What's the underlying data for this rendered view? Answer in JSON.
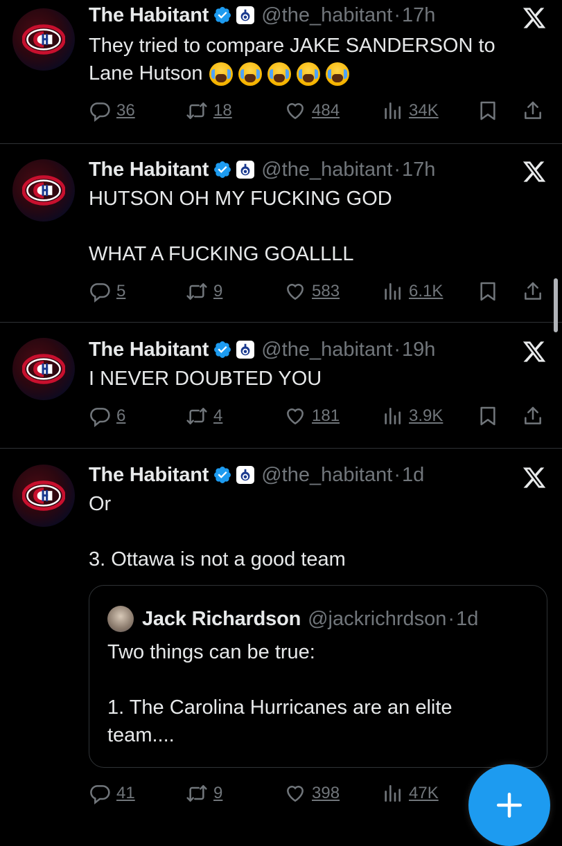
{
  "tweets": [
    {
      "name": "The Habitant",
      "handle": "@the_habitant",
      "dot": "·",
      "time": "17h",
      "text": "They tried to compare JAKE SANDERSON to Lane Hutson",
      "emojis": [
        "loudly-crying-face",
        "loudly-crying-face",
        "loudly-crying-face",
        "loudly-crying-face",
        "loudly-crying-face"
      ],
      "replies": "36",
      "reposts": "18",
      "likes": "484",
      "views": "34K"
    },
    {
      "name": "The Habitant",
      "handle": "@the_habitant",
      "dot": "·",
      "time": "17h",
      "text_line1": "HUTSON OH MY FUCKING GOD",
      "text_line2": "WHAT A FUCKING GOALLLL",
      "replies": "5",
      "reposts": "9",
      "likes": "583",
      "views": "6.1K"
    },
    {
      "name": "The Habitant",
      "handle": "@the_habitant",
      "dot": "·",
      "time": "19h",
      "text": "I NEVER DOUBTED YOU",
      "replies": "6",
      "reposts": "4",
      "likes": "181",
      "views": "3.9K"
    },
    {
      "name": "The Habitant",
      "handle": "@the_habitant",
      "dot": "·",
      "time": "1d",
      "text_line1": "Or",
      "text_line2": "3. Ottawa is not a good team",
      "quote": {
        "name": "Jack Richardson",
        "handle": "@jackrichrdson",
        "dot": "·",
        "time": "1d",
        "text_line1": "Two things can be true:",
        "text_line2": "1. The Carolina Hurricanes are an elite team...."
      },
      "replies": "41",
      "reposts": "9",
      "likes": "398",
      "views": "47K"
    }
  ],
  "icons": {
    "verified": "verified-badge-icon",
    "affiliate": "affiliate-badge-icon",
    "source": "x-logo-icon",
    "reply": "reply-icon",
    "repost": "repost-icon",
    "like": "heart-icon",
    "views": "views-icon",
    "bookmark": "bookmark-icon",
    "share": "share-icon",
    "compose": "plus-icon"
  },
  "colors": {
    "background": "#000000",
    "text": "#e7e9ea",
    "muted": "#71767b",
    "verified": "#1d9bf0",
    "fab": "#1d9bf0",
    "divider": "#2f3336"
  }
}
